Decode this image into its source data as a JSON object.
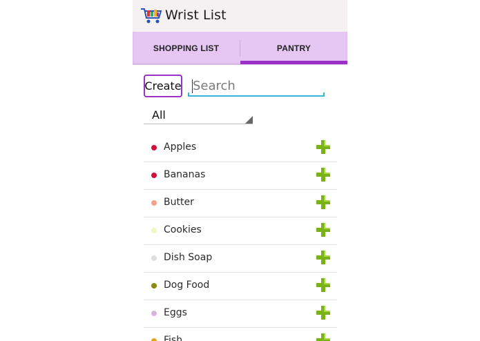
{
  "app": {
    "title": "Wrist List",
    "icon": "shopping-cart-icon"
  },
  "tabs": [
    {
      "label": "SHOPPING LIST",
      "selected": false
    },
    {
      "label": "PANTRY",
      "selected": true
    }
  ],
  "colors": {
    "accent": "#9b30c8",
    "tab_bar": "#e6c6f2",
    "search_underline": "#31b6d8",
    "add_icon": "#7ab317"
  },
  "toolbar": {
    "create_label": "Create",
    "search_placeholder": "Search",
    "search_value": ""
  },
  "filter": {
    "selected": "All"
  },
  "items": [
    {
      "name": "Apples",
      "dot_color": "#d0103a",
      "action_icon": "plus-icon"
    },
    {
      "name": "Bananas",
      "dot_color": "#d0103a",
      "action_icon": "plus-icon"
    },
    {
      "name": "Butter",
      "dot_color": "#f4a08a",
      "action_icon": "plus-icon"
    },
    {
      "name": "Cookies",
      "dot_color": "#eef7c6",
      "action_icon": "plus-icon"
    },
    {
      "name": "Dish Soap",
      "dot_color": "#dedede",
      "action_icon": "plus-icon"
    },
    {
      "name": "Dog Food",
      "dot_color": "#8a8a12",
      "action_icon": "plus-icon"
    },
    {
      "name": "Eggs",
      "dot_color": "#d8b4de",
      "action_icon": "plus-icon"
    },
    {
      "name": "Fish",
      "dot_color": "#e0a61a",
      "action_icon": "plus-icon"
    }
  ]
}
